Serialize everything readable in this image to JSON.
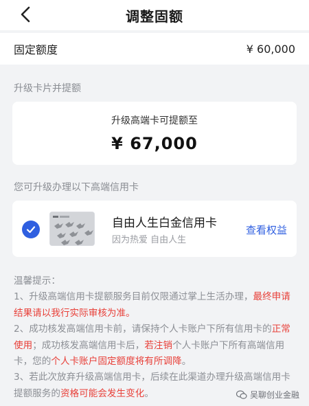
{
  "header": {
    "title": "调整固额"
  },
  "fixed": {
    "label": "固定额度",
    "value": "¥ 60,000"
  },
  "upgrade_section": {
    "title": "升级卡片并提额"
  },
  "amount_card": {
    "caption": "升级高端卡可提额至",
    "value": "¥ 67,000"
  },
  "cards_section": {
    "title": "您可升级办理以下高端信用卡"
  },
  "card": {
    "name": "自由人生白金信用卡",
    "slogan": "因为热爱 自由人生",
    "link": "查看权益",
    "selected": true
  },
  "tips": {
    "title": "温馨提示：",
    "p1_a": "1、升级高端信用卡提额服务目前仅限通过掌上生活办理，",
    "p1_b": "最终申请结果请以我行实际审核为准。",
    "p2_a": "2、成功核发高端信用卡前，请保持个人卡账户下所有信用卡的",
    "p2_b": "正常使用",
    "p2_c": "；成功核发高端信用卡后，",
    "p2_d": "若注销",
    "p2_e": "个人卡账户下所有高端信用卡，您的",
    "p2_f": "个人卡账户固定额度将有所调降",
    "p2_g": "。",
    "p3_a": "3、若此次放弃升级高端信用卡，后续在此渠道办理升级高端信用卡提额服务的",
    "p3_b": "资格可能会发生变化",
    "p3_c": "。"
  },
  "watermark": {
    "text": "吴聊创业金融"
  },
  "colors": {
    "accent": "#2f5fe0",
    "warning": "#e8413a",
    "muted": "#8c8f95"
  }
}
